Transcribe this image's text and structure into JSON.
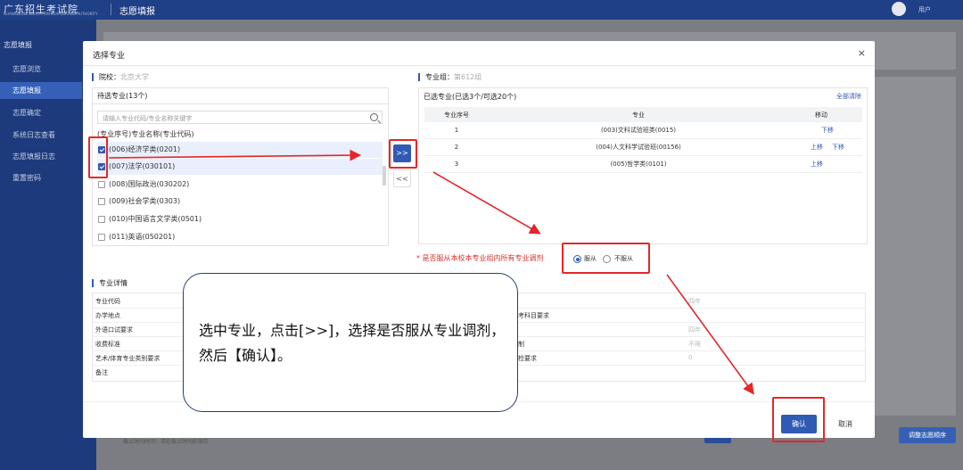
{
  "app": {
    "logo_text": "广东招生考试院",
    "logo_subtext": "GUANGDONG EDUCATION EXAMINATION AUTHORITY",
    "title": "志愿填报",
    "user_name": "用户"
  },
  "sidebar": {
    "items": [
      {
        "label": "志愿填报"
      },
      {
        "label": "志愿浏览"
      },
      {
        "label": "志愿填报"
      },
      {
        "label": "志愿确定"
      },
      {
        "label": "系统日志查看"
      },
      {
        "label": "志愿填报日志"
      },
      {
        "label": "重置密码"
      }
    ]
  },
  "background": {
    "bottom_left_text": "截止时间时间：请在截止时间前保存",
    "reset_button": "调整志愿顺序"
  },
  "dialog": {
    "title": "选择专业",
    "close": "×",
    "school_label": "院校：",
    "school_value": "北京大学",
    "group_label": "专业组：",
    "group_value": "第612组",
    "candidates": {
      "header": "待选专业(13个)",
      "search_placeholder": "请输入专业代码/专业名称关键字",
      "column_note": "(专业序号)专业名称(专业代码)",
      "items": [
        {
          "label": "(006)经济学类(0201)",
          "checked": true
        },
        {
          "label": "(007)法学(030101)",
          "checked": true
        },
        {
          "label": "(008)国际政治(030202)",
          "checked": false
        },
        {
          "label": "(009)社会学类(0303)",
          "checked": false
        },
        {
          "label": "(010)中国语言文学类(0501)",
          "checked": false
        },
        {
          "label": "(011)英语(050201)",
          "checked": false
        }
      ]
    },
    "move_add": ">>",
    "move_remove": "<<",
    "selected": {
      "header": "已选专业(已选3个/可选20个)",
      "clear_all": "全部清除",
      "columns": [
        "专业序号",
        "专业",
        "移动"
      ],
      "rows": [
        {
          "seq": "1",
          "name": "(003)文科试验班类(0015)",
          "actions": [
            "下移"
          ]
        },
        {
          "seq": "2",
          "name": "(004)人文科学试验班(00156)",
          "actions": [
            "上移",
            "下移"
          ]
        },
        {
          "seq": "3",
          "name": "(005)哲学类(0101)",
          "actions": [
            "上移"
          ]
        }
      ]
    },
    "adjust": {
      "question": "* 是否服从本校本专业组内所有专业调剂",
      "options": [
        "服从",
        "不服从"
      ],
      "selected": "服从"
    },
    "details": {
      "title": "专业详情",
      "left_labels": [
        "专业代码",
        "办学地点",
        "外语口试要求",
        "收费标准",
        "艺术/体育专业类别要求",
        "备注"
      ],
      "right_labels": [
        "选考科目要求",
        "学制",
        "体检要求"
      ],
      "right_values": [
        "四年",
        "四年",
        "不限",
        "0"
      ]
    },
    "confirm": "确认",
    "cancel": "取消"
  },
  "annotation": {
    "text": "选中专业，点击[>>]，选择是否服从专业调剂，然后【确认】。"
  },
  "colors": {
    "primary": "#2f5bb5",
    "annotation_red": "#e3272b",
    "sidebar": "#1d3a7c"
  }
}
